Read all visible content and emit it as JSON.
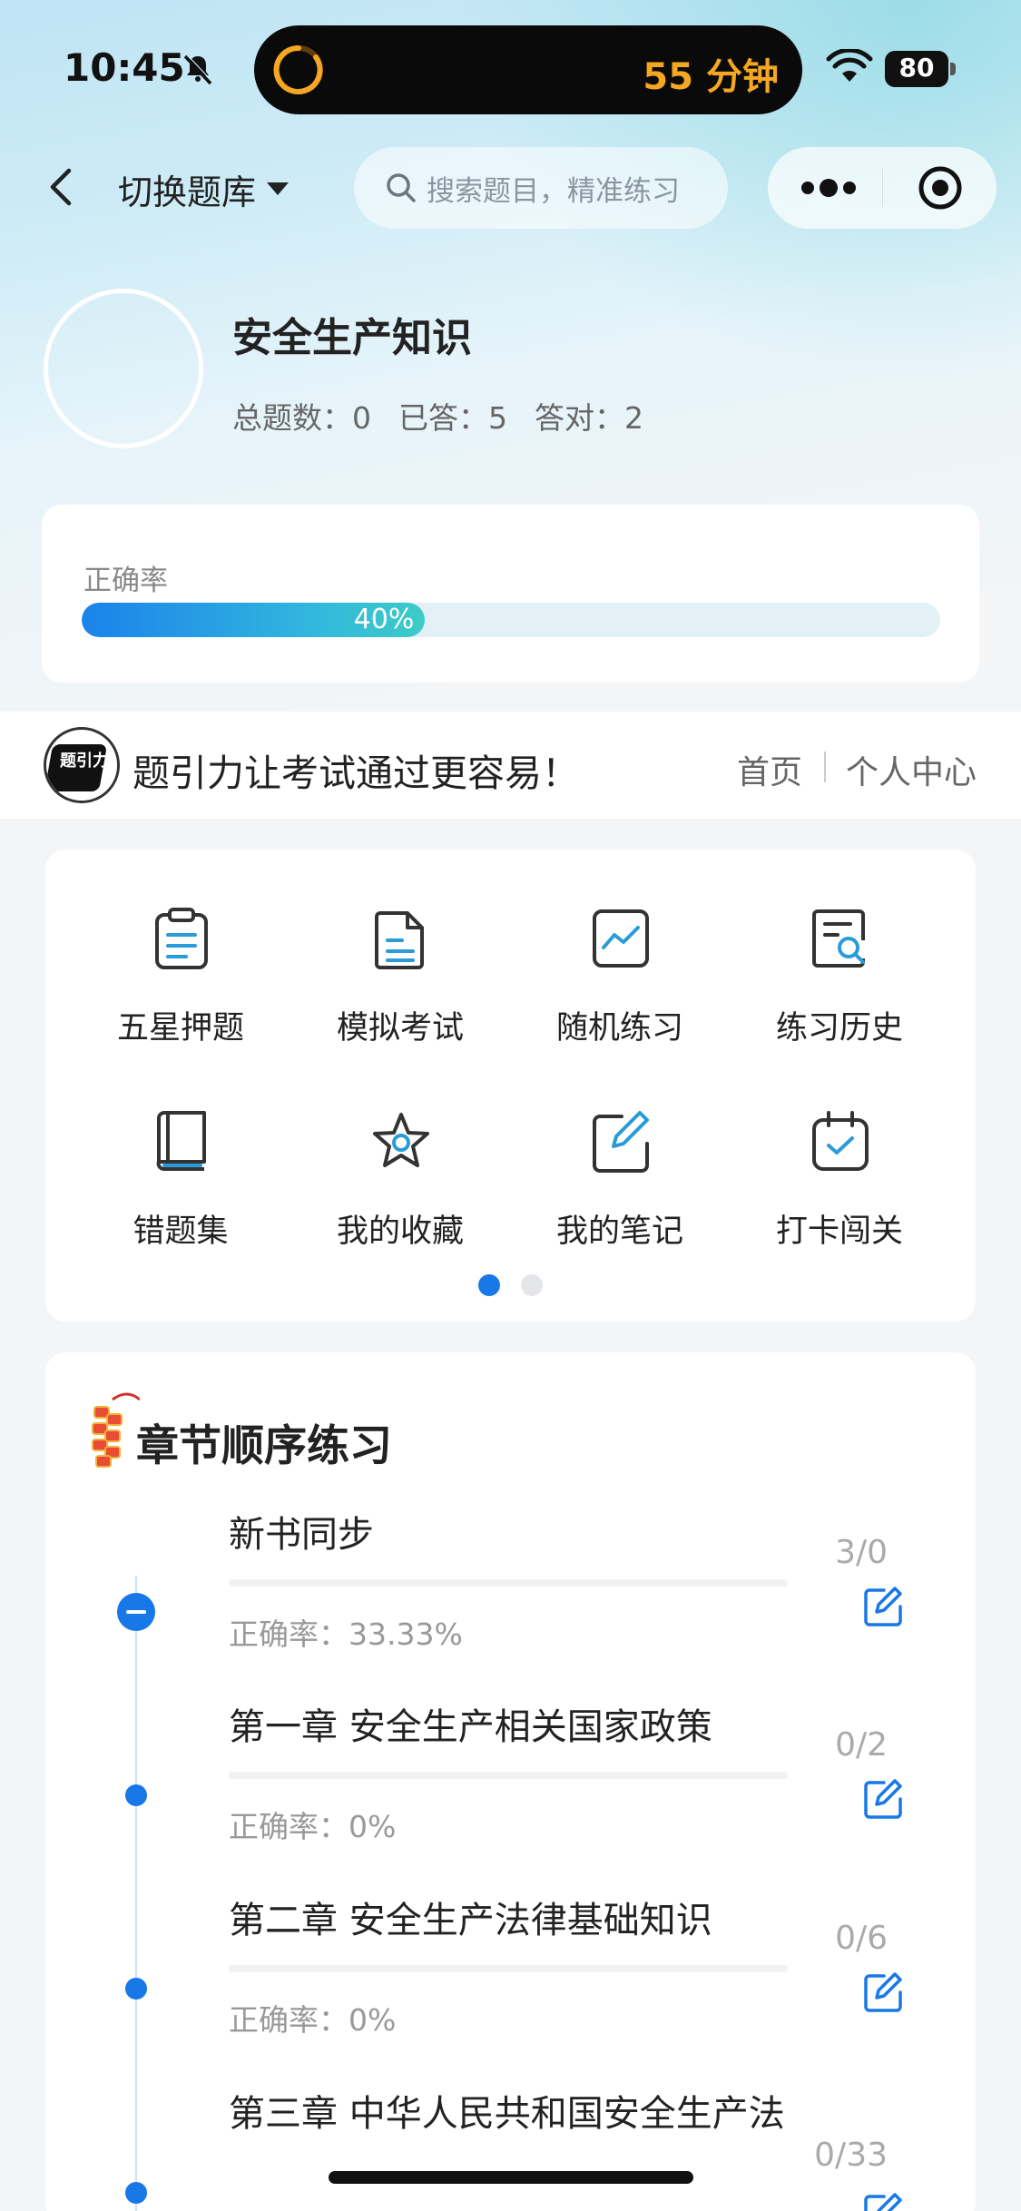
{
  "status_bar": {
    "time": "10:45",
    "timer_text": "55 分钟",
    "battery": "80"
  },
  "nav": {
    "switch_label": "切换题库",
    "search_placeholder": "搜索题目，精准练习"
  },
  "profile": {
    "title": "安全生产知识",
    "total_label": "总题数：0",
    "answered_label": "已答：5",
    "correct_label": "答对：2"
  },
  "accuracy": {
    "label": "正确率",
    "percent_text": "40%",
    "value": 0.4
  },
  "slogan": {
    "brand_text": "题引力",
    "text": "题引力让考试通过更容易！",
    "home": "首页",
    "personal_center": "个人中心"
  },
  "grid": {
    "items": [
      {
        "label": "五星押题",
        "icon": "clipboard-icon"
      },
      {
        "label": "模拟考试",
        "icon": "document-icon"
      },
      {
        "label": "随机练习",
        "icon": "chart-icon"
      },
      {
        "label": "练习历史",
        "icon": "search-document-icon"
      },
      {
        "label": "错题集",
        "icon": "book-icon"
      },
      {
        "label": "我的收藏",
        "icon": "star-icon"
      },
      {
        "label": "我的笔记",
        "icon": "edit-note-icon"
      },
      {
        "label": "打卡闯关",
        "icon": "calendar-check-icon"
      }
    ],
    "page_count": 2,
    "active_page": 1
  },
  "chapters": {
    "heading": "章节顺序练习",
    "items": [
      {
        "title": "新书同步",
        "accuracy": "正确率：33.33%",
        "count": "3/0",
        "expanded": true
      },
      {
        "title": "第一章 安全生产相关国家政策",
        "accuracy": "正确率：0%",
        "count": "0/2",
        "expanded": false
      },
      {
        "title": "第二章 安全生产法律基础知识",
        "accuracy": "正确率：0%",
        "count": "0/6",
        "expanded": false
      },
      {
        "title": "第三章 中华人民共和国安全生产法",
        "accuracy": "",
        "count": "0/33",
        "expanded": false
      }
    ]
  },
  "colors": {
    "accent": "#1878e8",
    "icon_blue": "#2a9bd8",
    "timer_orange": "#f5a623"
  }
}
